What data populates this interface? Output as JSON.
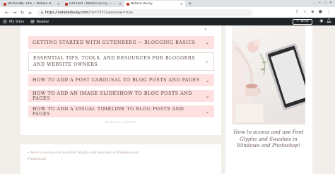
{
  "browser": {
    "tabs": [
      {
        "title": "BLOGGING TIPS ~ Natalie Ducey",
        "active": false,
        "favicon_color": "#c0392b"
      },
      {
        "title": "Edit Post ‹ Natalie Ducey — Wo",
        "active": false,
        "favicon_color": "#c0392b"
      },
      {
        "title": "Natalie Ducey",
        "active": true,
        "favicon_color": "#c0392b"
      }
    ],
    "new_tab": "+",
    "url_host": "https://natalieducey.com",
    "url_path": "/?p=7051&preview=true"
  },
  "wp_admin_bar": {
    "my_sites": "My Sites",
    "reader": "Reader",
    "write": "Write"
  },
  "accordion": {
    "items": [
      {
        "label": "GETTING STARTED WITH GUTENBERG ~ BLOGGING BASICS",
        "expanded": false
      },
      {
        "label": "ESSENTIAL TIPS, TOOLS, AND RESOURCES FOR BLOGGERS AND WEBSITE OWNERS",
        "expanded": true
      },
      {
        "label": "HOW TO ADD A POST CAROUSAL TO BLOG POSTS AND PAGES",
        "expanded": false
      },
      {
        "label": "HOW TO ADD AN IMAGE SLIDESHOW TO BLOG POSTS AND PAGES",
        "expanded": false
      },
      {
        "label": "HOW TO ADD A VISUAL TIMELINE TO BLOG POSTS AND PAGES",
        "expanded": false
      }
    ],
    "caption": "SEARCH & COMMENT"
  },
  "teaser_text": "« How to access and use Font Glyphs and Swashes in Windows and Photoshop!",
  "sidebar": {
    "feature_title": "How to access and use Font Glyphs and Swashes in Windows and Photoshop!"
  },
  "colors": {
    "accordion_bg": "#fde0df",
    "admin_bar": "#1d2327",
    "page_bg": "#f2eee9"
  }
}
